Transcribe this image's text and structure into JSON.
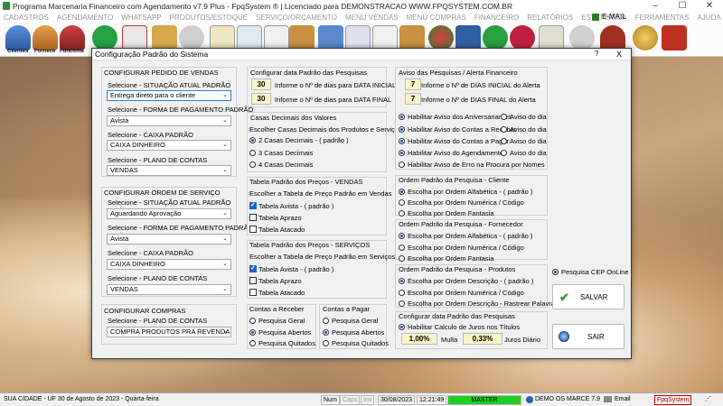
{
  "app": {
    "title": "Programa Marcenaria Financeiro com Agendamento v7.9 Plus - FpqSystem ® | Licenciado para  DEMONSTRACAO WWW.FPQSYSTEM.COM.BR"
  },
  "menu": [
    "CADASTROS",
    "AGENDAMENTO",
    "WHATSAPP",
    "PRODUTOS/ESTOQUE",
    "SERVIÇO/ORÇAMENTO",
    "MENU VENDAS",
    "MENU COMPRAS",
    "FINANCEIRO",
    "RELATÓRIOS",
    "ESTATÍSTICA",
    "FERRAMENTAS",
    "AJUDA",
    "E-MAIL"
  ],
  "toolbar": {
    "clientes": "Clientes",
    "fornecedores": "Fornece",
    "funcionarios": "Funciona"
  },
  "dialog": {
    "title": "Configuração Padrão do Sistema",
    "help": "?",
    "close": "X",
    "pedido": {
      "title": "CONFIGURAR PEDIDO DE VENDAS",
      "l1": "Selecione - SITUAÇÃO ATUAL PADRÃO",
      "v1": "Entrega direto para o cliente",
      "l2": "Selecione - FORMA DE PAGAMENTO PADRÃO",
      "v2": "Avista",
      "l3": "Selecione - CAIXA PADRÃO",
      "v3": "CAIXA DINHEIRO",
      "l4": "Selecione - PLANO DE CONTAS",
      "v4": "VENDAS"
    },
    "servico": {
      "title": "CONFIGURAR ORDEM DE SERVIÇO",
      "l1": "Selecione - SITUAÇÃO ATUAL PADRÃO",
      "v1": "Aguardando Aprovação",
      "l2": "Selecione - FORMA DE PAGAMENTO PADRÃO",
      "v2": "Avista",
      "l3": "Selecione - CAIXA PADRÃO",
      "v3": "CAIXA DINHEIRO",
      "l4": "Selecione - PLANO DE CONTAS",
      "v4": "VENDAS"
    },
    "compras": {
      "title": "CONFIGURAR COMPRAS",
      "l1": "Selecione - PLANO DE CONTAS",
      "v1": "COMPRA PRODUTOS PRA REVENDA"
    },
    "datas": {
      "title": "Configurar data Padrão das Pesquisas",
      "n1": "30",
      "l1": "Informe o Nº de dias para DATA INICIAL",
      "n2": "30",
      "l2": "Informe o Nº de dias para DATA FINAL"
    },
    "decimais": {
      "title": "Casas Decimais dos Valores",
      "sub": "Escolher Casas Decimais dos Produtos e Serviços",
      "o1": "2 Casas Decimais - ( padrão )",
      "o2": "3 Casas Decimais",
      "o3": "4 Casas Decimais"
    },
    "precoVendas": {
      "title": "Tabela Padrão dos Preços - VENDAS",
      "sub": "Escolher a Tabela de Preço Padrão em Vendas",
      "o1": "Tabela Avista - ( padrão )",
      "o2": "Tabela Aprazo",
      "o3": "Tabela Atacado"
    },
    "precoServicos": {
      "title": "Tabela Padrão dos Preços - SERVIÇOS",
      "sub": "Escolher a Tabela de Preço Padrão em Serviços",
      "o1": "Tabela Avista - ( padrão )",
      "o2": "Tabela Aprazo",
      "o3": "Tabela Atacado"
    },
    "receber": {
      "title": "Contas a Receber",
      "o1": "Pesquisa Geral",
      "o2": "Pesquisa Abertos",
      "o3": "Pesquisa Quitados"
    },
    "pagar": {
      "title": "Contas a Pagar",
      "o1": "Pesquisa Geral",
      "o2": "Pesquisa Abertos",
      "o3": "Pesquisa Quitados"
    },
    "aviso": {
      "title": "Aviso das Pesquisas / Alerta Financeiro",
      "n1": "7",
      "l1": "Informe o Nº de DIAS INICIAL do Alerta",
      "n2": "7",
      "l2": "Informe o Nº de DIAS FINAL do Alerta",
      "c1": "Habilitar Aviso dos Aniversariantes",
      "c2": "Habilitar Aviso do Contas a Receber",
      "c3": "Habilitar Aviso do Contas a Pagar",
      "c4": "Habilitar Aviso do Agendamento",
      "c5": "Habilitar Aviso de Erro na Procura por Nomes",
      "dia": "Aviso do dia"
    },
    "ordCliente": {
      "title": "Ordem Padrão da Pesquisa - Cliente",
      "o1": "Escolha por Ordem Alfabética - ( padrão )",
      "o2": "Escolha por Ordem Numérica / Código",
      "o3": "Escolha por Ordem Fantasia"
    },
    "ordFornecedor": {
      "title": "Ordem Padrão da Pesquisa - Fornecedor",
      "o1": "Escolha por Ordem Alfabética - ( padrão )",
      "o2": "Escolha por Ordem Numérica / Código",
      "o3": "Escolha por Ordem Fantasia"
    },
    "ordProdutos": {
      "title": "Ordem Padrão da Pesquisa - Produtos",
      "o1": "Escolha por Ordem Descrição - ( padrão )",
      "o2": "Escolha por Ordem Numérica / Código",
      "o3": "Escolha por Ordem Descrição - Rastrear Palavra"
    },
    "juros": {
      "title": "Configurar data Padrão das Pesquisas",
      "c1": "Habilitar Calculo de Juros nos Títulos",
      "multa": "1,00%",
      "multaLbl": "Multa",
      "juros": "0,33%",
      "jurosLbl": "Juros Diário"
    },
    "cep": "Pesquisa CEP OnLine",
    "salvar": "SALVAR",
    "sair": "SAIR"
  },
  "status": {
    "cidade": "SUA CIDADE - UF 30 de Agosto de 2023 - Quarta-feira",
    "num": "Num",
    "caps": "Caps",
    "ins": "Ins",
    "data": "30/08/2023",
    "hora": "12:21:49",
    "master": "MASTER",
    "demo": "DEMO OS MARCE 7.9",
    "email": "Email",
    "brand": "FpqSystem"
  }
}
